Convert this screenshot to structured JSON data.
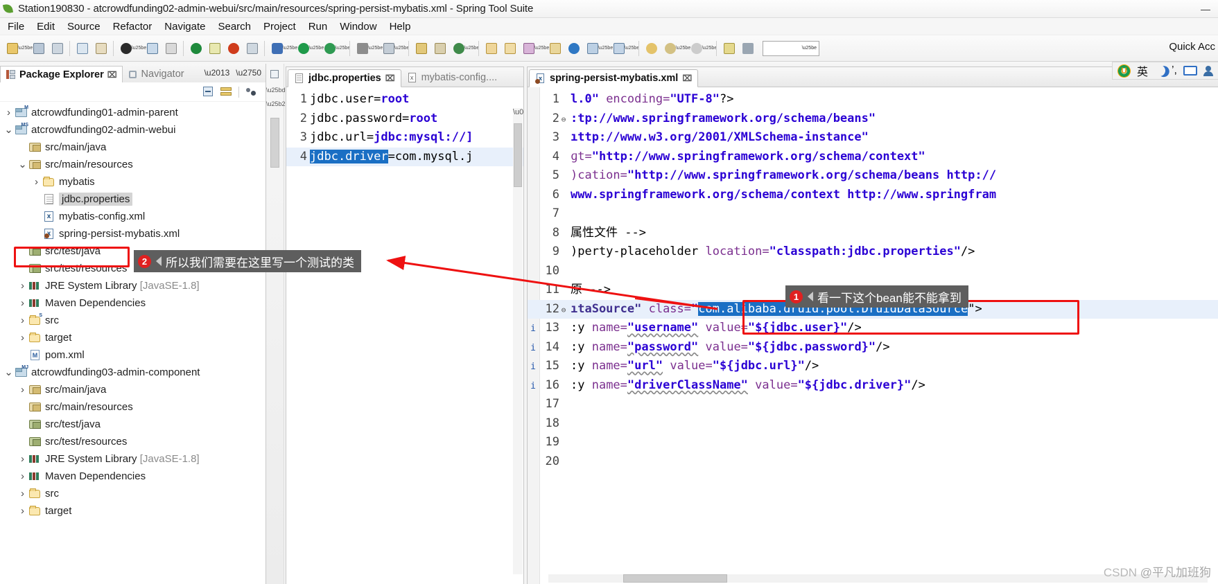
{
  "window": {
    "title": "Station190830 - atcrowdfunding02-admin-webui/src/main/resources/spring-persist-mybatis.xml - Spring Tool Suite",
    "minimize": "—",
    "maximize": "❐",
    "close": "✕"
  },
  "menubar": {
    "items": [
      "File",
      "Edit",
      "Source",
      "Refactor",
      "Navigate",
      "Search",
      "Project",
      "Run",
      "Window",
      "Help"
    ]
  },
  "toolbar": {
    "combo_value": "",
    "quick_access": "Quick Acc"
  },
  "ime": {
    "logo": "sogou-logo-icon",
    "mode_label": "英",
    "moon": "moon-icon",
    "comma": "’,",
    "keyboard": "keyboard-icon",
    "person": "person-icon"
  },
  "package_explorer": {
    "tabs": [
      {
        "label": "Package Explorer",
        "icon": "package-explorer-icon",
        "active": true,
        "close": "⌧"
      },
      {
        "label": "Navigator",
        "icon": "navigator-icon",
        "active": false,
        "close": ""
      }
    ],
    "view_buttons": [
      "collapse-all-icon",
      "link-with-editor-icon",
      "view-menu-icon"
    ],
    "panel_controls": [
      "minimize-icon",
      "maximize-icon"
    ],
    "tree": [
      {
        "indent": 0,
        "twisty": "collapsed",
        "icon": "project-maven",
        "badge": "M",
        "label": "atcrowdfunding01-admin-parent",
        "dim": ""
      },
      {
        "indent": 0,
        "twisty": "expanded",
        "icon": "project-maven-spring",
        "badge": "MS",
        "label": "atcrowdfunding02-admin-webui",
        "dim": ""
      },
      {
        "indent": 1,
        "twisty": "none",
        "icon": "package-src",
        "badge": "",
        "label": "src/main/java",
        "dim": ""
      },
      {
        "indent": 1,
        "twisty": "expanded",
        "icon": "package-src",
        "badge": "",
        "label": "src/main/resources",
        "dim": ""
      },
      {
        "indent": 2,
        "twisty": "collapsed",
        "icon": "folder",
        "badge": "",
        "label": "mybatis",
        "dim": ""
      },
      {
        "indent": 2,
        "twisty": "none",
        "icon": "file",
        "badge": "",
        "label": "jdbc.properties",
        "dim": "",
        "selected": true
      },
      {
        "indent": 2,
        "twisty": "none",
        "icon": "xml",
        "badge": "",
        "label": "mybatis-config.xml",
        "dim": ""
      },
      {
        "indent": 2,
        "twisty": "none",
        "icon": "spring-xml",
        "badge": "",
        "label": "spring-persist-mybatis.xml",
        "dim": ""
      },
      {
        "indent": 1,
        "twisty": "none",
        "icon": "package-test",
        "badge": "",
        "label": "src/test/java",
        "dim": "",
        "highlight": true
      },
      {
        "indent": 1,
        "twisty": "none",
        "icon": "package-test",
        "badge": "",
        "label": "src/test/resources",
        "dim": ""
      },
      {
        "indent": 1,
        "twisty": "collapsed",
        "icon": "library",
        "badge": "",
        "label": "JRE System Library",
        "dim": "[JavaSE-1.8]"
      },
      {
        "indent": 1,
        "twisty": "collapsed",
        "icon": "library",
        "badge": "",
        "label": "Maven Dependencies",
        "dim": ""
      },
      {
        "indent": 1,
        "twisty": "collapsed",
        "icon": "folder-src",
        "badge": "S",
        "label": "src",
        "dim": ""
      },
      {
        "indent": 1,
        "twisty": "collapsed",
        "icon": "folder",
        "badge": "",
        "label": "target",
        "dim": ""
      },
      {
        "indent": 1,
        "twisty": "none",
        "icon": "pom",
        "badge": "",
        "label": "pom.xml",
        "dim": ""
      },
      {
        "indent": 0,
        "twisty": "expanded",
        "icon": "project-maven-java",
        "badge": "MJ",
        "label": "atcrowdfunding03-admin-component",
        "dim": ""
      },
      {
        "indent": 1,
        "twisty": "collapsed",
        "icon": "package-src",
        "badge": "",
        "label": "src/main/java",
        "dim": ""
      },
      {
        "indent": 1,
        "twisty": "none",
        "icon": "package-src",
        "badge": "",
        "label": "src/main/resources",
        "dim": ""
      },
      {
        "indent": 1,
        "twisty": "none",
        "icon": "package-test",
        "badge": "",
        "label": "src/test/java",
        "dim": ""
      },
      {
        "indent": 1,
        "twisty": "none",
        "icon": "package-test",
        "badge": "",
        "label": "src/test/resources",
        "dim": ""
      },
      {
        "indent": 1,
        "twisty": "collapsed",
        "icon": "library",
        "badge": "",
        "label": "JRE System Library",
        "dim": "[JavaSE-1.8]"
      },
      {
        "indent": 1,
        "twisty": "collapsed",
        "icon": "library",
        "badge": "",
        "label": "Maven Dependencies",
        "dim": ""
      },
      {
        "indent": 1,
        "twisty": "collapsed",
        "icon": "folder",
        "badge": "",
        "label": "src",
        "dim": ""
      },
      {
        "indent": 1,
        "twisty": "collapsed",
        "icon": "folder",
        "badge": "",
        "label": "target",
        "dim": ""
      }
    ]
  },
  "editor_left": {
    "tabs": [
      {
        "label": "jdbc.properties",
        "icon": "properties-file-icon",
        "active": true,
        "close": "⌧"
      },
      {
        "label": "mybatis-config....",
        "icon": "xml-file-icon",
        "active": false,
        "close": ""
      }
    ],
    "lines": [
      {
        "num": "1",
        "segments": [
          {
            "t": "jdbc.user=",
            "c": "plain"
          },
          {
            "t": "root",
            "c": "val"
          }
        ]
      },
      {
        "num": "2",
        "segments": [
          {
            "t": "jdbc.password=",
            "c": "plain"
          },
          {
            "t": "root",
            "c": "val"
          }
        ]
      },
      {
        "num": "3",
        "segments": [
          {
            "t": "jdbc.url=",
            "c": "plain"
          },
          {
            "t": "jdbc:mysql://]",
            "c": "val"
          }
        ]
      },
      {
        "num": "4",
        "selected_line": true,
        "segments": [
          {
            "t": "jdbc.driver",
            "c": "sel"
          },
          {
            "t": "=com.mysql.j",
            "c": "plain"
          }
        ]
      }
    ]
  },
  "editor_right": {
    "tabs": [
      {
        "label": "spring-persist-mybatis.xml",
        "icon": "spring-xml-file-icon",
        "active": true,
        "close": "⌧"
      }
    ],
    "lines": [
      {
        "num": "1",
        "ann": "",
        "fold": "",
        "segments": [
          {
            "t": "l.0\"",
            "c": "val"
          },
          {
            "t": " encoding=",
            "c": "attr"
          },
          {
            "t": "\"UTF-8\"",
            "c": "val"
          },
          {
            "t": "?>",
            "c": "punct"
          }
        ]
      },
      {
        "num": "2",
        "ann": "",
        "fold": "⊖",
        "segments": [
          {
            "t": ":tp://www.springframework.org/schema/beans\"",
            "c": "val"
          }
        ]
      },
      {
        "num": "3",
        "ann": "",
        "fold": "",
        "segments": [
          {
            "t": "ıttp://www.w3.org/2001/XMLSchema-instance\"",
            "c": "val"
          }
        ]
      },
      {
        "num": "4",
        "ann": "",
        "fold": "",
        "segments": [
          {
            "t": "ɡt=",
            "c": "attr"
          },
          {
            "t": "\"http://www.springframework.org/schema/context\"",
            "c": "val"
          }
        ]
      },
      {
        "num": "5",
        "ann": "",
        "fold": "",
        "segments": [
          {
            "t": ")cation=",
            "c": "attr"
          },
          {
            "t": "\"http://www.springframework.org/schema/beans http://",
            "c": "val"
          }
        ]
      },
      {
        "num": "6",
        "ann": "",
        "fold": "",
        "segments": [
          {
            "t": "www.springframework.org/schema/context http://www.springfram",
            "c": "val"
          }
        ]
      },
      {
        "num": "7",
        "ann": "",
        "fold": "",
        "segments": [
          {
            "t": "",
            "c": "plain"
          }
        ]
      },
      {
        "num": "8",
        "ann": "",
        "fold": "",
        "segments": [
          {
            "t": "属性文件 -->",
            "c": "plain"
          }
        ]
      },
      {
        "num": "9",
        "ann": "",
        "fold": "",
        "segments": [
          {
            "t": ")perty-placeholder ",
            "c": "plain"
          },
          {
            "t": "location=",
            "c": "attr"
          },
          {
            "t": "\"classpath:jdbc.properties\"",
            "c": "val"
          },
          {
            "t": "/>",
            "c": "punct"
          }
        ]
      },
      {
        "num": "10",
        "ann": "",
        "fold": "",
        "segments": [
          {
            "t": "",
            "c": "plain"
          }
        ]
      },
      {
        "num": "11",
        "ann": "",
        "fold": "",
        "segments": [
          {
            "t": "原 -->",
            "c": "plain"
          }
        ]
      },
      {
        "num": "12",
        "ann": "",
        "fold": "⊖",
        "selected_line": true,
        "segments": [
          {
            "t": "ıtaSource\"",
            "c": "tag"
          },
          {
            "t": " class=",
            "c": "attr"
          },
          {
            "t": "\"",
            "c": "val"
          },
          {
            "t": "com.alibaba.druid.pool.DruidDataSource",
            "c": "sel"
          },
          {
            "t": "\">",
            "c": "punct"
          }
        ]
      },
      {
        "num": "13",
        "ann": "i",
        "fold": "",
        "segments": [
          {
            "t": ":y ",
            "c": "plain"
          },
          {
            "t": "name=",
            "c": "attr"
          },
          {
            "t": "\"username\"",
            "c": "val",
            "squiggle": true
          },
          {
            "t": " value=",
            "c": "attr"
          },
          {
            "t": "\"${jdbc.user}\"",
            "c": "val"
          },
          {
            "t": "/>",
            "c": "punct"
          }
        ]
      },
      {
        "num": "14",
        "ann": "i",
        "fold": "",
        "segments": [
          {
            "t": ":y ",
            "c": "plain"
          },
          {
            "t": "name=",
            "c": "attr"
          },
          {
            "t": "\"password\"",
            "c": "val",
            "squiggle": true
          },
          {
            "t": " value=",
            "c": "attr"
          },
          {
            "t": "\"${jdbc.password}\"",
            "c": "val"
          },
          {
            "t": "/>",
            "c": "punct"
          }
        ]
      },
      {
        "num": "15",
        "ann": "i",
        "fold": "",
        "segments": [
          {
            "t": ":y ",
            "c": "plain"
          },
          {
            "t": "name=",
            "c": "attr"
          },
          {
            "t": "\"url\"",
            "c": "val",
            "squiggle": true
          },
          {
            "t": " value=",
            "c": "attr"
          },
          {
            "t": "\"${jdbc.url}\"",
            "c": "val"
          },
          {
            "t": "/>",
            "c": "punct"
          }
        ]
      },
      {
        "num": "16",
        "ann": "i",
        "fold": "",
        "segments": [
          {
            "t": ":y ",
            "c": "plain"
          },
          {
            "t": "name=",
            "c": "attr"
          },
          {
            "t": "\"driverClassName\"",
            "c": "val",
            "squiggle": true
          },
          {
            "t": " value=",
            "c": "attr"
          },
          {
            "t": "\"${jdbc.driver}\"",
            "c": "val"
          },
          {
            "t": "/>",
            "c": "punct"
          }
        ]
      },
      {
        "num": "17",
        "ann": "",
        "fold": "",
        "segments": [
          {
            "t": "",
            "c": "plain"
          }
        ]
      },
      {
        "num": "18",
        "ann": "",
        "fold": "",
        "segments": [
          {
            "t": "",
            "c": "plain"
          }
        ]
      },
      {
        "num": "19",
        "ann": "",
        "fold": "",
        "segments": [
          {
            "t": "",
            "c": "plain"
          }
        ]
      },
      {
        "num": "20",
        "ann": "",
        "fold": "",
        "segments": [
          {
            "t": "",
            "c": "plain"
          }
        ]
      }
    ]
  },
  "annotations": [
    {
      "id": 1,
      "number": "1",
      "text": "看一下这个bean能不能拿到"
    },
    {
      "id": 2,
      "number": "2",
      "text": "所以我们需要在这里写一个测试的类"
    }
  ],
  "watermark": {
    "csdn": "CSDN",
    "author": "@平凡加班狗"
  },
  "colors": {
    "annotation_red": "#ee1111",
    "callout_bg": "#5e5e5e",
    "selection_blue": "#1a6fc4",
    "string_blue": "#2a00d4",
    "attr_purple": "#7b2f8f"
  }
}
